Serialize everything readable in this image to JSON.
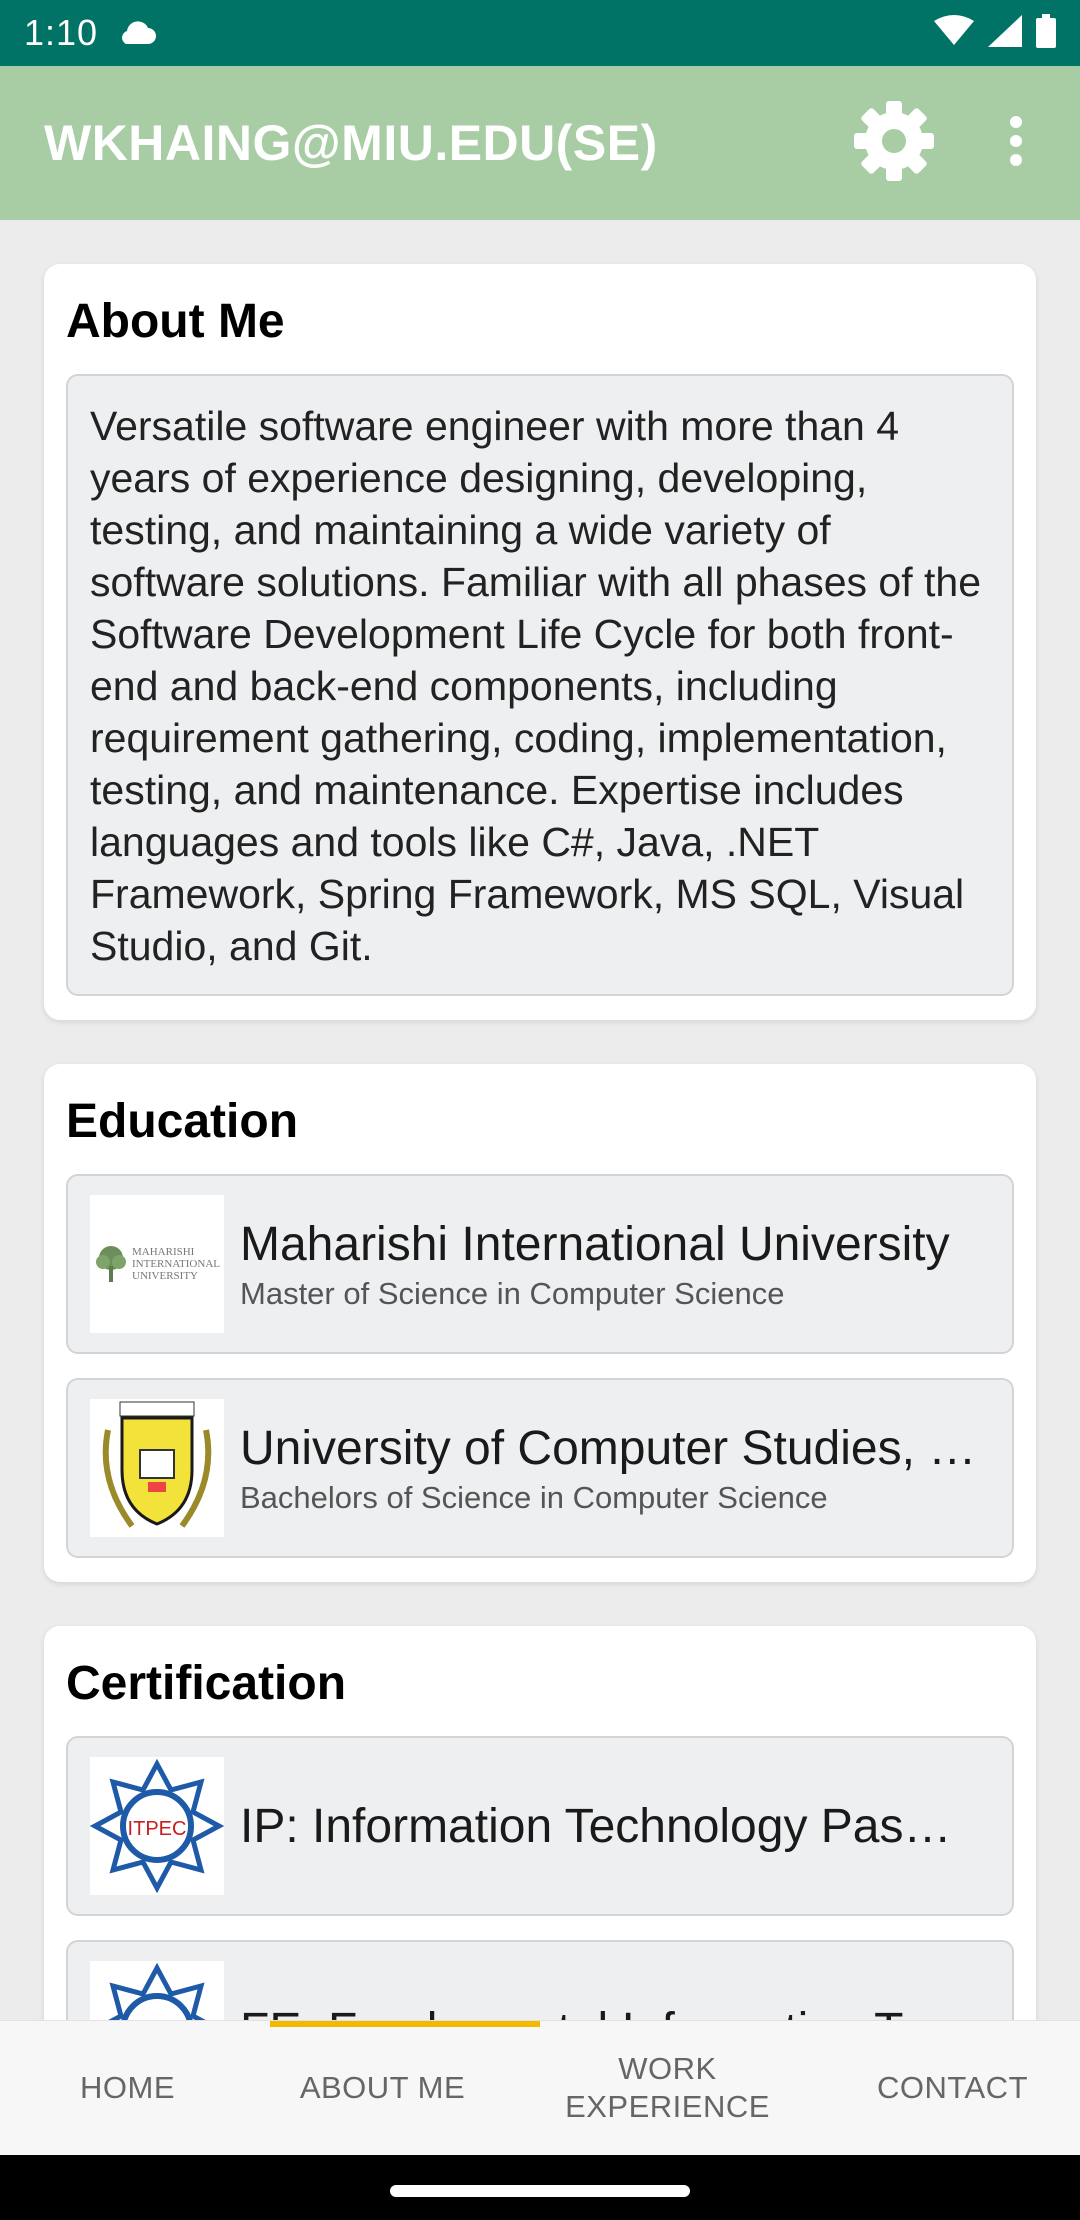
{
  "status_bar": {
    "time": "1:10"
  },
  "app_bar": {
    "title": "WKHAING@MIU.EDU(SE)"
  },
  "about": {
    "title": "About Me",
    "text": "Versatile software engineer with more than 4 years of experience designing, developing, testing, and maintaining a wide variety of software solutions. Familiar with all phases of the Software Development Life Cycle for both front-end and back-end components, including requirement gathering, coding, implementation, testing, and maintenance. Expertise includes languages and tools like C#, Java, .NET Framework, Spring Framework, MS SQL, Visual Studio, and Git."
  },
  "education": {
    "title": "Education",
    "items": [
      {
        "school": "Maharishi International University",
        "degree": "Master of Science in Computer Science",
        "logo_lines": [
          "MAHARISHI",
          "INTERNATIONAL",
          "UNIVERSITY"
        ]
      },
      {
        "school": "University of Computer Studies, …",
        "degree": "Bachelors of Science in Computer Science"
      }
    ]
  },
  "certification": {
    "title": "Certification",
    "items": [
      {
        "name": "IP: Information Technology Pas…",
        "logo_text": "ITPEC"
      },
      {
        "name": "FE: Fundamental Information Te…"
      }
    ]
  },
  "bottom_nav": {
    "tabs": [
      "HOME",
      "ABOUT ME",
      "WORK EXPERIENCE",
      "CONTACT"
    ],
    "selected_index": 1
  },
  "colors": {
    "status_bar": "#017366",
    "app_bar": "#a8cda4",
    "indicator": "#f5b800",
    "card_box": "#eeeff1"
  }
}
